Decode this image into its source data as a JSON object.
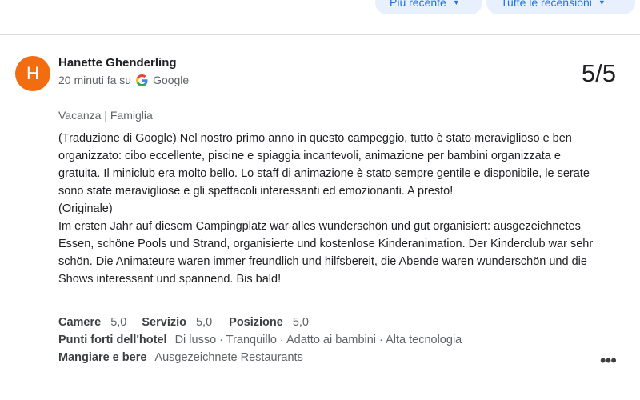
{
  "filters": {
    "sort_label": "Più recente",
    "scope_label": "Tutte le recensioni"
  },
  "review": {
    "avatar_initial": "H",
    "reviewer": "Hanette Ghenderling",
    "time": "20 minuti fa su",
    "source": "Google",
    "score": "5/5",
    "trip_type": "Vacanza",
    "trip_sep": "|",
    "trip_company": "Famiglia",
    "translation": "(Traduzione di Google) Nel nostro primo anno in questo campeggio, tutto è stato meraviglioso e ben organizzato: cibo eccellente, piscine e spiaggia incantevoli, animazione per bambini organizzata e gratuita. Il miniclub era molto bello. Lo staff di animazione è stato sempre gentile e disponibile, le serate sono state meravigliose e gli spettacoli interessanti ed emozionanti. A presto!",
    "original_label": "(Originale)",
    "original": "Im ersten Jahr auf diesem Campingplatz war alles wunderschön und gut organisiert: ausgezeichnetes Essen, schöne Pools und Strand, organisierte und kostenlose Kinderanimation. Der Kinderclub war sehr schön. Die Animateure waren immer freundlich und hilfsbereit, die Abende waren wunderschön und die Shows interessant und spannend. Bis bald!",
    "ratings": [
      {
        "label": "Camere",
        "value": "5,0"
      },
      {
        "label": "Servizio",
        "value": "5,0"
      },
      {
        "label": "Posizione",
        "value": "5,0"
      }
    ],
    "highlights_label": "Punti forti dell'hotel",
    "highlights_value": "Di lusso · Tranquillo · Adatto ai bambini · Alta tecnologia",
    "food_label": "Mangiare e bere",
    "food_value": "Ausgezeichnete Restaurants"
  },
  "icons": {
    "dropdown": "caret-down-icon",
    "source_logo": "google-g-icon",
    "more": "more-horizontal-icon"
  },
  "colors": {
    "avatar": "#f26d10",
    "chip_bg": "#e8f0fe",
    "chip_text": "#1a73e8"
  }
}
